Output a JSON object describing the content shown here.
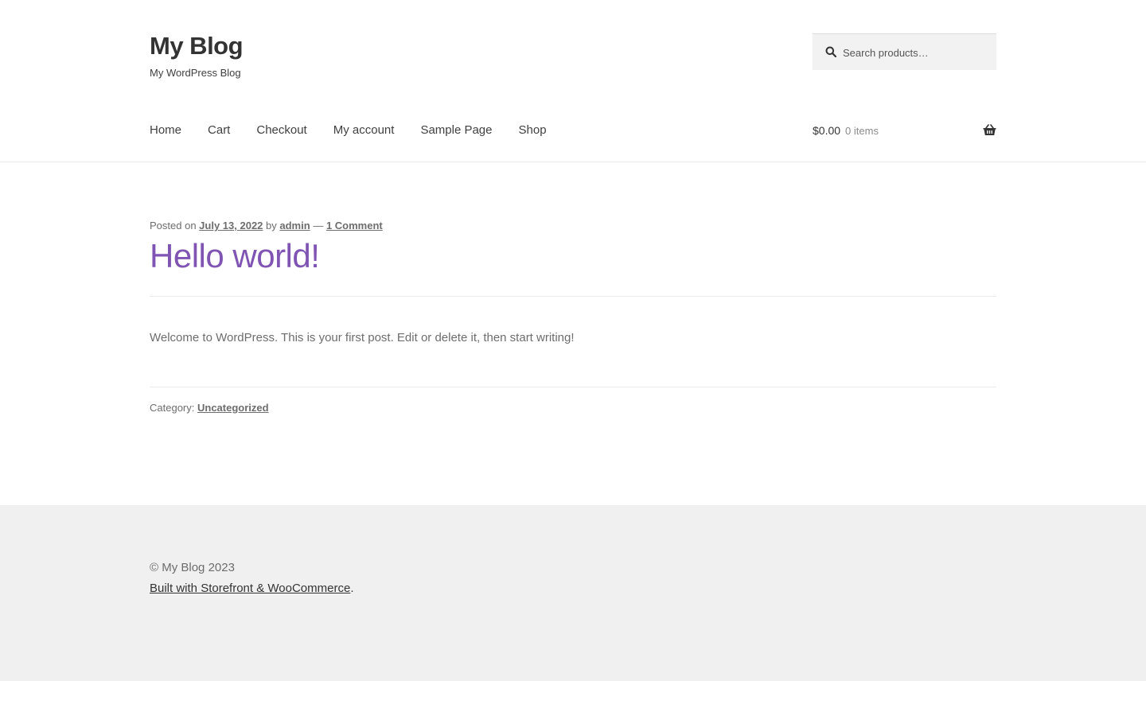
{
  "header": {
    "site_title": "My Blog",
    "site_description": "My WordPress Blog",
    "search": {
      "placeholder": "Search products…",
      "value": ""
    },
    "nav": [
      "Home",
      "Cart",
      "Checkout",
      "My account",
      "Sample Page",
      "Shop"
    ],
    "cart": {
      "amount": "$0.00",
      "count": "0 items"
    }
  },
  "post": {
    "meta": {
      "posted_on": "Posted on",
      "date": "July 13, 2022",
      "by": "by",
      "author": "admin",
      "dash": "—",
      "comments": "1 Comment"
    },
    "title": "Hello world!",
    "content": "Welcome to WordPress. This is your first post. Edit or delete it, then start writing!",
    "category_label": "Category:",
    "category": "Uncategorized"
  },
  "footer": {
    "copyright": "© My Blog 2023",
    "credit_link": "Built with Storefront & WooCommerce",
    "credit_suffix": "."
  },
  "colors": {
    "accent": "#7f54b3",
    "text": "#6d6d6d",
    "heading": "#333333",
    "footer_bg": "#f0f0f0"
  },
  "icons": {
    "search": "search-icon",
    "cart": "basket-icon"
  }
}
